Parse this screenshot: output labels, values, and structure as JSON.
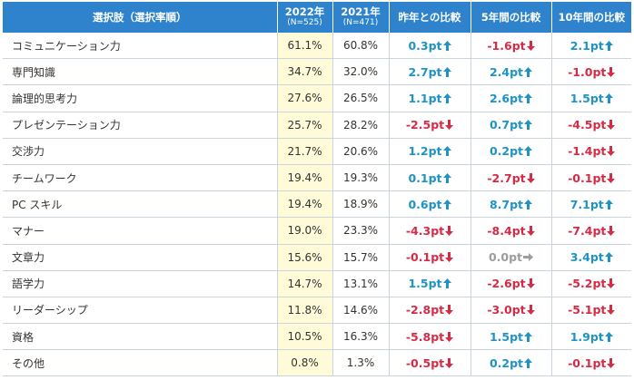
{
  "header": {
    "item": "選択肢（選択率順）",
    "year2022": "2022年",
    "year2022_n": "(N=525)",
    "year2021": "2021年",
    "year2021_n": "(N=471)",
    "diff_1y": "昨年との比較",
    "diff_5y": "5年間の比較",
    "diff_10y": "10年間の比較"
  },
  "colors": {
    "header_bg": "#2e83cc",
    "highlight_bg": "#fffbd9",
    "up": "#1f93c4",
    "down": "#d62b45",
    "flat": "#9c9c9c"
  },
  "rows": [
    {
      "name": "コミュニケーション力",
      "y2022": "61.1%",
      "y2021": "60.8%",
      "d1": {
        "text": "0.3pt",
        "dir": "up"
      },
      "d5": {
        "text": "-1.6pt",
        "dir": "down"
      },
      "d10": {
        "text": "2.1pt",
        "dir": "up"
      }
    },
    {
      "name": "専門知識",
      "y2022": "34.7%",
      "y2021": "32.0%",
      "d1": {
        "text": "2.7pt",
        "dir": "up"
      },
      "d5": {
        "text": "2.4pt",
        "dir": "up"
      },
      "d10": {
        "text": "-1.0pt",
        "dir": "down"
      }
    },
    {
      "name": "論理的思考力",
      "y2022": "27.6%",
      "y2021": "26.5%",
      "d1": {
        "text": "1.1pt",
        "dir": "up"
      },
      "d5": {
        "text": "2.6pt",
        "dir": "up"
      },
      "d10": {
        "text": "1.5pt",
        "dir": "up"
      }
    },
    {
      "name": "プレゼンテーション力",
      "y2022": "25.7%",
      "y2021": "28.2%",
      "d1": {
        "text": "-2.5pt",
        "dir": "down"
      },
      "d5": {
        "text": "0.7pt",
        "dir": "up"
      },
      "d10": {
        "text": "-4.5pt",
        "dir": "down"
      }
    },
    {
      "name": "交渉力",
      "y2022": "21.7%",
      "y2021": "20.6%",
      "d1": {
        "text": "1.2pt",
        "dir": "up"
      },
      "d5": {
        "text": "0.2pt",
        "dir": "up"
      },
      "d10": {
        "text": "-1.4pt",
        "dir": "down"
      }
    },
    {
      "name": "チームワーク",
      "y2022": "19.4%",
      "y2021": "19.3%",
      "d1": {
        "text": "0.1pt",
        "dir": "up"
      },
      "d5": {
        "text": "-2.7pt",
        "dir": "down"
      },
      "d10": {
        "text": "-0.1pt",
        "dir": "down"
      }
    },
    {
      "name": "PC スキル",
      "y2022": "19.4%",
      "y2021": "18.9%",
      "d1": {
        "text": "0.6pt",
        "dir": "up"
      },
      "d5": {
        "text": "8.7pt",
        "dir": "up"
      },
      "d10": {
        "text": "7.1pt",
        "dir": "up"
      }
    },
    {
      "name": "マナー",
      "y2022": "19.0%",
      "y2021": "23.3%",
      "d1": {
        "text": "-4.3pt",
        "dir": "down"
      },
      "d5": {
        "text": "-8.4pt",
        "dir": "down"
      },
      "d10": {
        "text": "-7.4pt",
        "dir": "down"
      }
    },
    {
      "name": "文章力",
      "y2022": "15.6%",
      "y2021": "15.7%",
      "d1": {
        "text": "-0.1pt",
        "dir": "down"
      },
      "d5": {
        "text": "0.0pt",
        "dir": "flat"
      },
      "d10": {
        "text": "3.4pt",
        "dir": "up"
      }
    },
    {
      "name": "語学力",
      "y2022": "14.7%",
      "y2021": "13.1%",
      "d1": {
        "text": "1.5pt",
        "dir": "up"
      },
      "d5": {
        "text": "-2.6pt",
        "dir": "down"
      },
      "d10": {
        "text": "-5.2pt",
        "dir": "down"
      }
    },
    {
      "name": "リーダーシップ",
      "y2022": "11.8%",
      "y2021": "14.6%",
      "d1": {
        "text": "-2.8pt",
        "dir": "down"
      },
      "d5": {
        "text": "-3.0pt",
        "dir": "down"
      },
      "d10": {
        "text": "-5.1pt",
        "dir": "down"
      }
    },
    {
      "name": "資格",
      "y2022": "10.5%",
      "y2021": "16.3%",
      "d1": {
        "text": "-5.8pt",
        "dir": "down"
      },
      "d5": {
        "text": "1.5pt",
        "dir": "up"
      },
      "d10": {
        "text": "1.9pt",
        "dir": "up"
      }
    },
    {
      "name": "その他",
      "y2022": "0.8%",
      "y2021": "1.3%",
      "d1": {
        "text": "-0.5pt",
        "dir": "down"
      },
      "d5": {
        "text": "0.2pt",
        "dir": "up"
      },
      "d10": {
        "text": "-0.1pt",
        "dir": "down"
      }
    }
  ]
}
